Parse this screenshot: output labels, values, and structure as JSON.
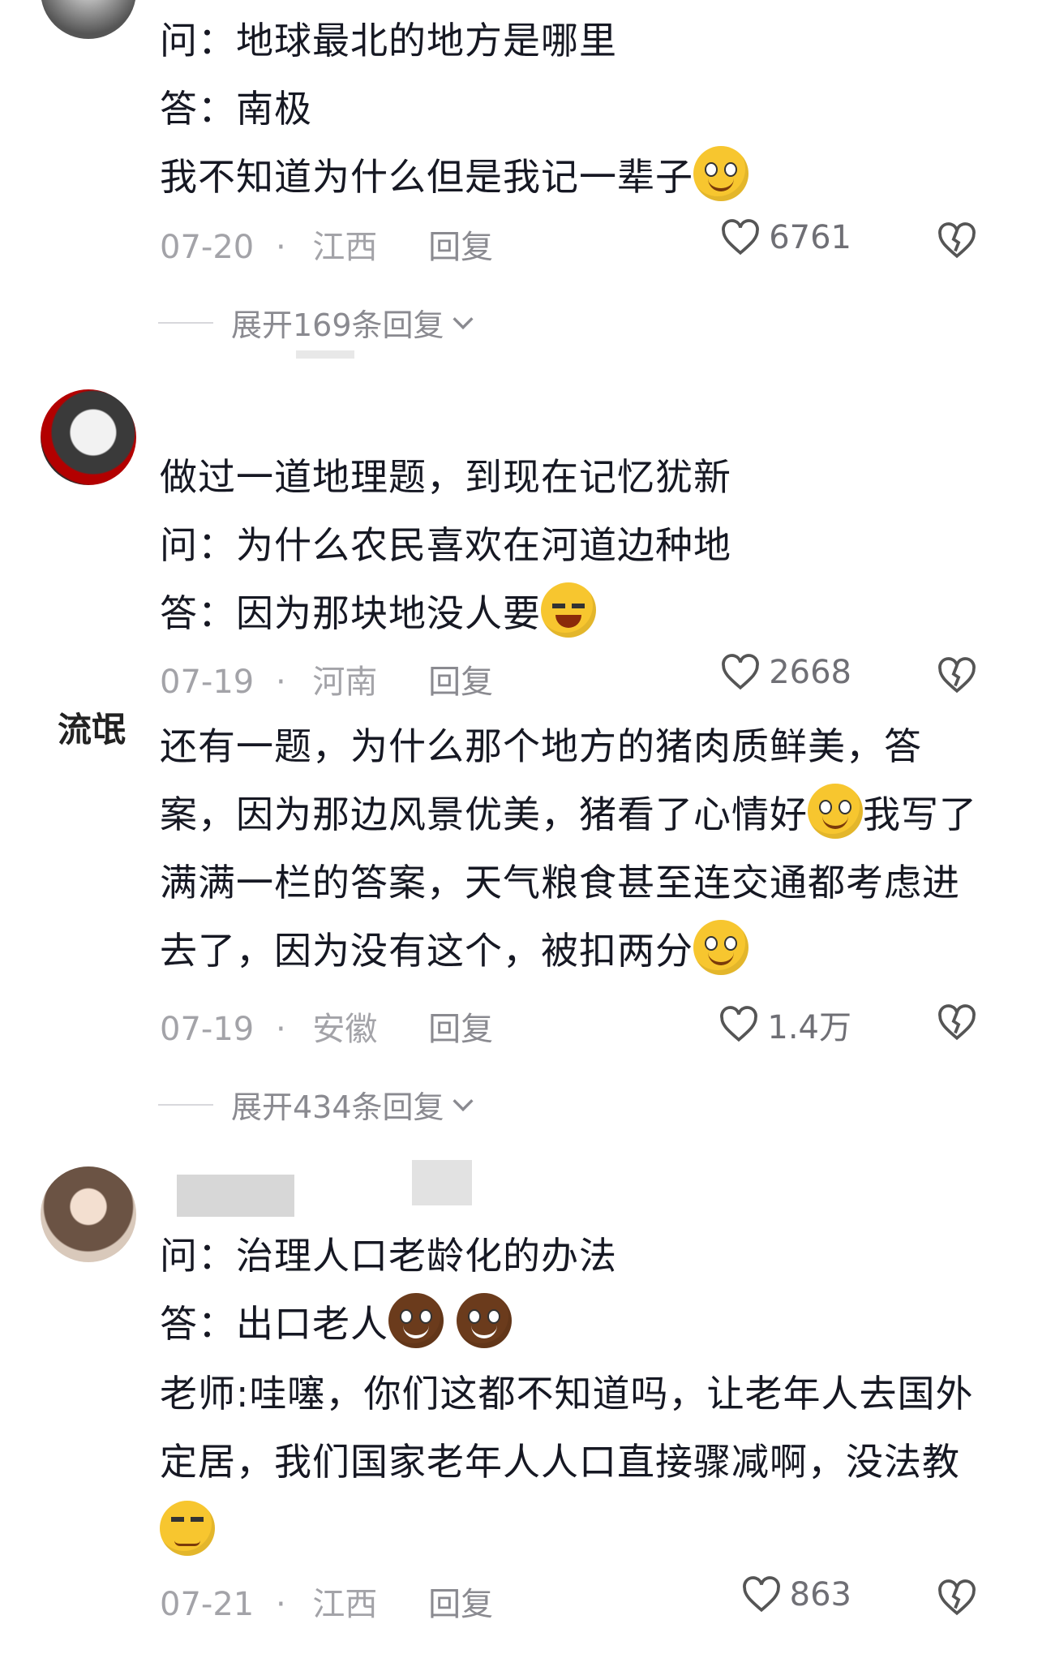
{
  "comments": [
    {
      "lines": [
        "问：地球最北的地方是哪里",
        "答：南极",
        "我不知道为什么但是我记一辈子"
      ],
      "date": "07-20",
      "location": "江西",
      "reply_label": "回复",
      "likes": "6761",
      "expand_label": "展开169条回复"
    },
    {
      "lines": [
        "做过一道地理题，到现在记忆犹新",
        "问：为什么农民喜欢在河道边种地",
        "答：因为那块地没人要"
      ],
      "date": "07-19",
      "location": "河南",
      "reply_label": "回复",
      "likes": "2668"
    },
    {
      "avatar_text": "流氓",
      "lines": [
        "还有一题，为什么那个地方的猪肉质鲜美，答",
        "案，因为那边风景优美，猪看了心情好",
        "我写了",
        "满满一栏的答案，天气粮食甚至连交通都考虑进",
        "去了，因为没有这个，被扣两分"
      ],
      "date": "07-19",
      "location": "安徽",
      "reply_label": "回复",
      "likes": "1.4万",
      "expand_label": "展开434条回复"
    },
    {
      "lines": [
        "问：治理人口老龄化的办法",
        "答：出口老人",
        "老师:哇噻，你们这都不知道吗，让老年人去国外",
        "定居，我们国家老年人人口直接骤减啊，没法教"
      ],
      "date": "07-21",
      "location": "江西",
      "reply_label": "回复",
      "likes": "863"
    }
  ],
  "separator": "·",
  "icons": {
    "like": "heart-outline-icon",
    "dislike": "broken-heart-icon",
    "expand": "chevron-down-icon"
  },
  "colors": {
    "text": "#161823",
    "meta": "#a3a3a8",
    "emoji": "#f7c62f"
  }
}
